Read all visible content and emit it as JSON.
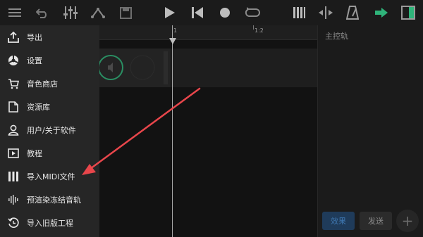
{
  "toolbar": {
    "icons": [
      "menu-icon",
      "undo-icon",
      "mixer-icon",
      "automation-icon",
      "save-icon",
      "play-icon",
      "skip-back-icon",
      "record-icon",
      "loop-icon",
      "piano-icon",
      "split-icon",
      "metronome-icon",
      "export-arrow-icon",
      "panel-toggle-icon"
    ],
    "accent_color": "#2fb47a"
  },
  "timeline": {
    "marker_1": "1",
    "marker_2": "1:2"
  },
  "right_panel": {
    "title": "主控轨",
    "effects_button": "效果",
    "send_button": "发送",
    "add_button": "+"
  },
  "menu": {
    "items": [
      {
        "label": "导出",
        "icon": "export-icon"
      },
      {
        "label": "设置",
        "icon": "settings-icon"
      },
      {
        "label": "音色商店",
        "icon": "cart-icon"
      },
      {
        "label": "资源库",
        "icon": "document-icon"
      },
      {
        "label": "用户/关于软件",
        "icon": "user-icon"
      },
      {
        "label": "教程",
        "icon": "video-icon"
      },
      {
        "label": "导入MIDI文件",
        "icon": "piano-keys-icon"
      },
      {
        "label": "预渲染冻结音轨",
        "icon": "waveform-icon"
      },
      {
        "label": "导入旧版工程",
        "icon": "restore-icon"
      }
    ]
  },
  "annotation": {
    "arrow_color": "#e8464b"
  }
}
